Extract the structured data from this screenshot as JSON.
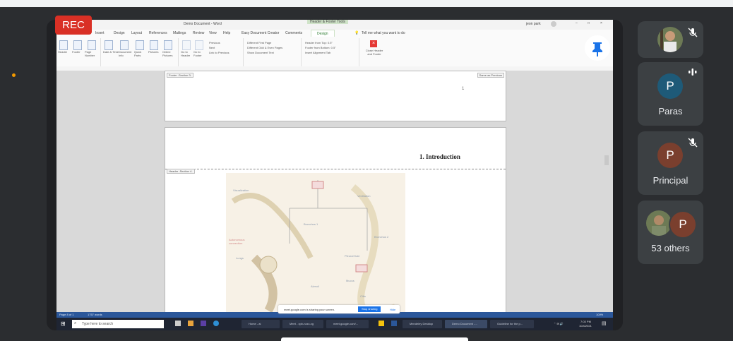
{
  "recording": {
    "label": "REC"
  },
  "word": {
    "title": "Demo Document - Word",
    "contextual_tab": "Header & Footer Tools",
    "tell_me": "Tell me what you want to do",
    "user": "jeon park",
    "tabs": [
      "Insert",
      "Design",
      "Layout",
      "References",
      "Mailings",
      "Review",
      "View",
      "Help",
      "Easy Document Creator",
      "Comments",
      "Design"
    ],
    "ribbon_groups": [
      {
        "label": "Header & Footer",
        "buttons": [
          "Header",
          "Footer",
          "Page Number"
        ]
      },
      {
        "label": "Insert",
        "buttons": [
          "Date & Time",
          "Document Info",
          "Quick Parts",
          "Pictures",
          "Online Pictures"
        ]
      },
      {
        "label": "Navigation",
        "buttons": [
          "Go to Header",
          "Go to Footer",
          "Previous",
          "Next",
          "Link to Previous"
        ]
      },
      {
        "label": "Options",
        "buttons": [
          "Different First Page",
          "Different Odd & Even Pages",
          "Show Document Text"
        ]
      },
      {
        "label": "Position",
        "buttons": [
          "Header from Top: 0.5\"",
          "Footer from Bottom: 0.5\"",
          "Insert Alignment Tab"
        ]
      },
      {
        "label": "Close",
        "buttons": [
          "Close Header and Footer"
        ]
      }
    ],
    "footer_tag": "Footer -Section 3-",
    "same_as_previous": "Same as Previous",
    "header_tag": "Header -Section 4-",
    "page_marker": "1",
    "heading": "1. Introduction",
    "diagram_labels": [
      "Visualization",
      "Ventilation",
      "Autonomous connection",
      "Bronchus 1",
      "Bronchus 2",
      "Pleural fluid",
      "Lungs",
      "Mucus",
      "Alveoli",
      "Cilia"
    ],
    "status": {
      "page": "Page 8 of 1",
      "words": "1757 words",
      "zoom": "100%"
    },
    "sharing_bar": {
      "message": "meet.google.com is sharing your screen.",
      "stop": "Stop sharing",
      "hide": "Hide"
    },
    "taskbar": {
      "search_placeholder": "Type here to search",
      "apps": [
        "Home - ai",
        "Meet - xpb-nzzc-xg",
        "meet.google.com/...",
        "Mendeley Desktop",
        "Demo Document -...",
        "Guideline for the p..."
      ],
      "time": "7:03 PM",
      "date": "10/4/2021"
    }
  },
  "participants": [
    {
      "name": "",
      "initial": "",
      "muted": true,
      "speaking": false,
      "type": "photo"
    },
    {
      "name": "Paras",
      "initial": "P",
      "muted": false,
      "speaking": true,
      "color": "#1e5a78"
    },
    {
      "name": "Principal",
      "initial": "P",
      "muted": true,
      "speaking": false,
      "color": "#7a3f2e"
    },
    {
      "name": "53 others",
      "initial": "P",
      "muted": false,
      "speaking": false,
      "color": "#7a3f2e",
      "type": "group"
    }
  ],
  "colors": {
    "rec": "#d93025",
    "word_blue": "#2b579a",
    "tile": "#3c4043",
    "stage": "#2b2d30"
  }
}
